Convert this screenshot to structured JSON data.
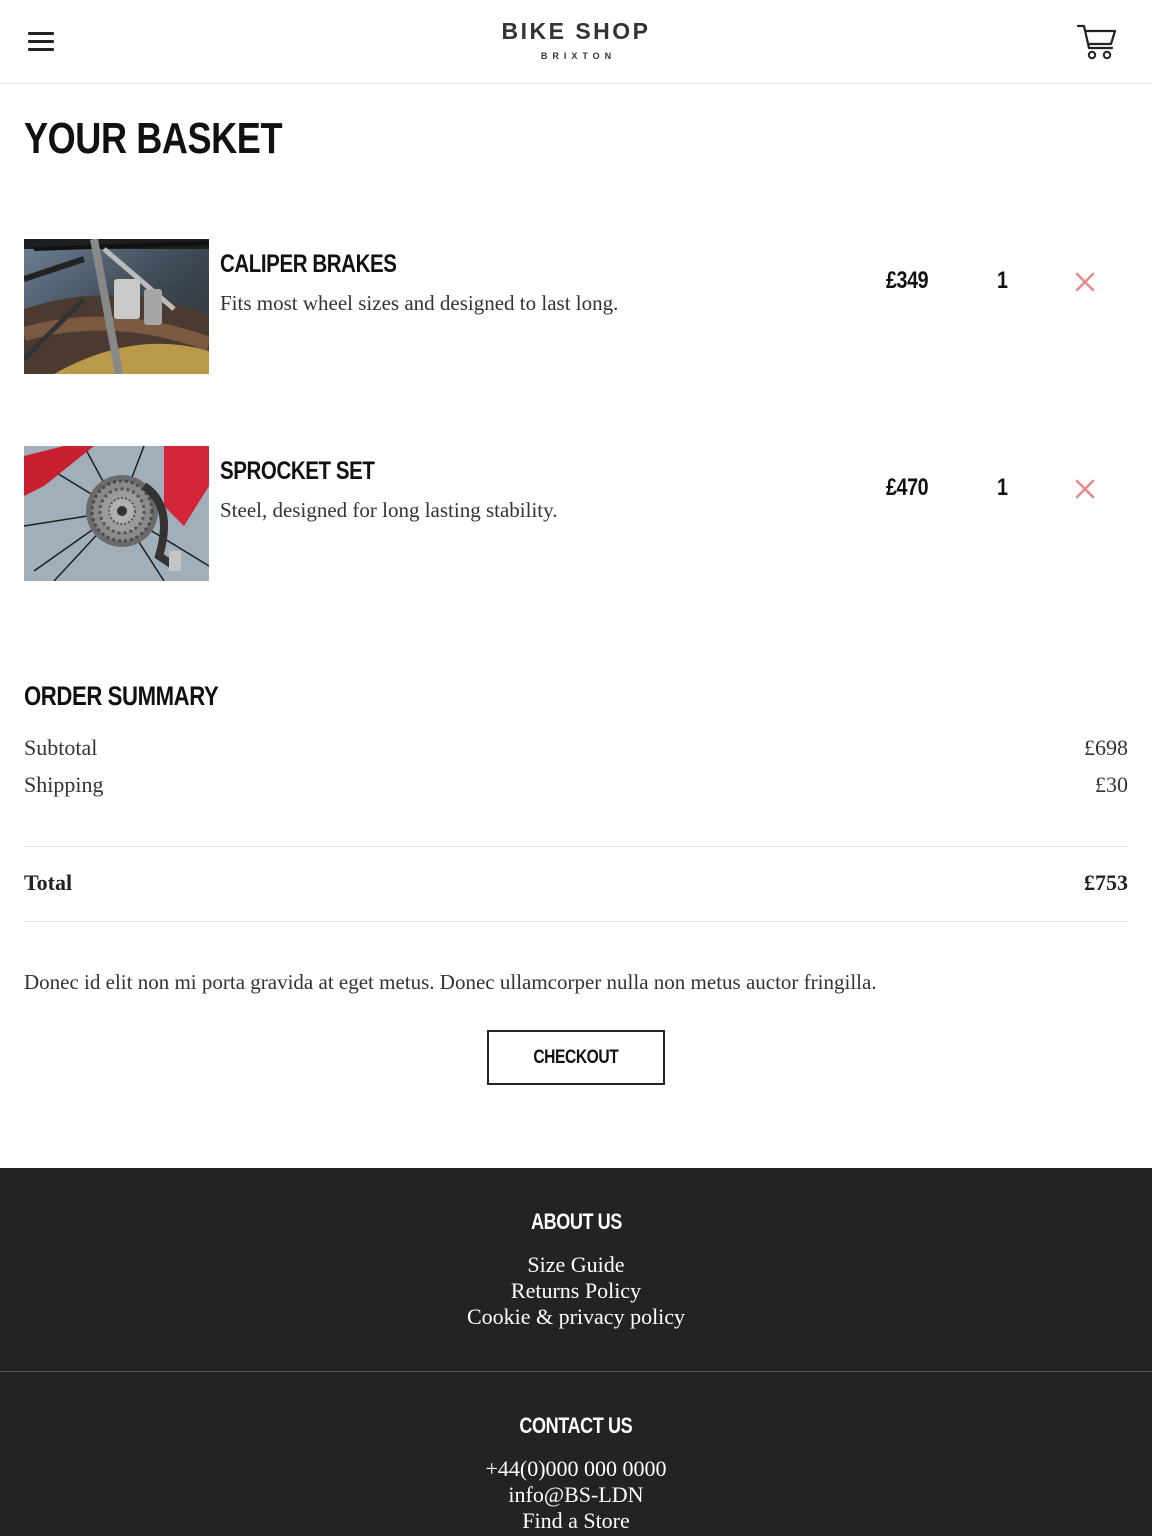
{
  "header": {
    "logo_title": "BIKE SHOP",
    "logo_subtitle": "BRIXTON",
    "menu_icon": "hamburger-menu-icon",
    "cart_icon": "shopping-cart-icon"
  },
  "page_title": "YOUR BASKET",
  "basket": {
    "items": [
      {
        "name": "CALIPER BRAKES",
        "description": "Fits most wheel sizes and designed to last long.",
        "price": "£349",
        "quantity": "1",
        "remove_icon": "close-icon"
      },
      {
        "name": "SPROCKET SET",
        "description": "Steel, designed for long lasting stability.",
        "price": "£470",
        "quantity": "1",
        "remove_icon": "close-icon"
      }
    ]
  },
  "order_summary": {
    "title": "ORDER SUMMARY",
    "subtotal_label": "Subtotal",
    "subtotal_value": "£698",
    "shipping_label": "Shipping",
    "shipping_value": "£30",
    "total_label": "Total",
    "total_value": "£753",
    "note": "Donec id elit non mi porta gravida at eget metus. Donec ullamcorper nulla non metus auctor fringilla.",
    "checkout_label": "CHECKOUT"
  },
  "footer": {
    "about_heading": "ABOUT US",
    "about_links": [
      "Size Guide",
      "Returns Policy",
      "Cookie & privacy policy"
    ],
    "contact_heading": "CONTACT US",
    "contact_links": [
      "+44(0)000 000 0000",
      "info@BS-LDN",
      "Find a Store"
    ]
  },
  "colors": {
    "remove_icon": "#e88a8a",
    "footer_background": "#232323",
    "text": "#222222"
  }
}
